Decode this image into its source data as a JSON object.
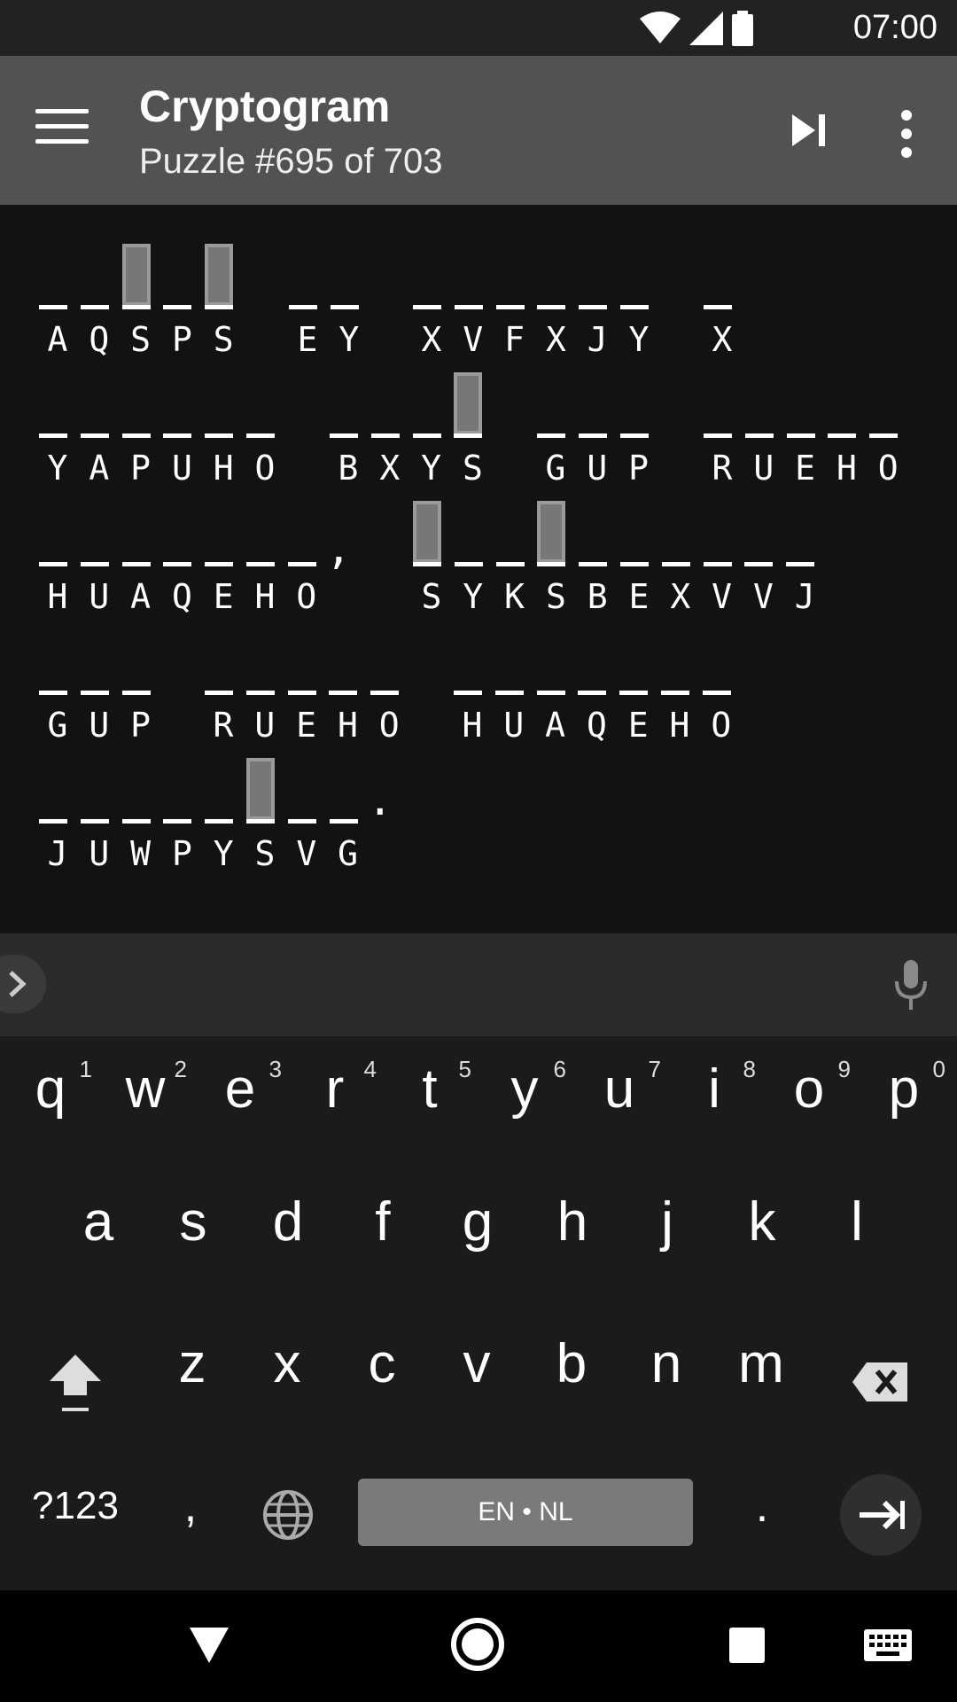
{
  "status": {
    "time": "07:00"
  },
  "app": {
    "title": "Cryptogram",
    "subtitle": "Puzzle #695 of 703"
  },
  "puzzle": {
    "lines": [
      {
        "words": [
          {
            "letters": "AQSPS",
            "start": 46
          },
          {
            "letters": "EY",
            "start": 328
          },
          {
            "letters": "XVFXJY",
            "start": 468
          },
          {
            "letters": "X",
            "start": 796
          }
        ]
      },
      {
        "words": [
          {
            "letters": "YAPUHO",
            "start": 46
          },
          {
            "letters": "BXYS",
            "start": 374
          },
          {
            "letters": "GUP",
            "start": 608
          },
          {
            "letters": "RUEHO",
            "start": 796
          }
        ]
      },
      {
        "words": [
          {
            "letters": "HUAQEHO",
            "start": 46
          },
          {
            "letters": "SYKSBEXVVJ",
            "start": 468
          }
        ],
        "punct": [
          {
            "char": ",",
            "after_word": 0
          }
        ]
      },
      {
        "words": [
          {
            "letters": "GUP",
            "start": 46
          },
          {
            "letters": "RUEHO",
            "start": 233
          },
          {
            "letters": "HUAQEHO",
            "start": 514
          }
        ]
      },
      {
        "words": [
          {
            "letters": "JUWPYSVG",
            "start": 46
          }
        ],
        "punct": [
          {
            "char": ".",
            "after_word": 0
          }
        ]
      }
    ],
    "highlight_letter": "S"
  },
  "keyboard": {
    "row1": [
      "q",
      "w",
      "e",
      "r",
      "t",
      "y",
      "u",
      "i",
      "o",
      "p"
    ],
    "row1_hints": [
      "1",
      "2",
      "3",
      "4",
      "5",
      "6",
      "7",
      "8",
      "9",
      "0"
    ],
    "row2": [
      "a",
      "s",
      "d",
      "f",
      "g",
      "h",
      "j",
      "k",
      "l"
    ],
    "row3": [
      "z",
      "x",
      "c",
      "v",
      "b",
      "n",
      "m"
    ],
    "symbols_label": "?123",
    "comma": ",",
    "period": ".",
    "space_label": "EN • NL"
  }
}
